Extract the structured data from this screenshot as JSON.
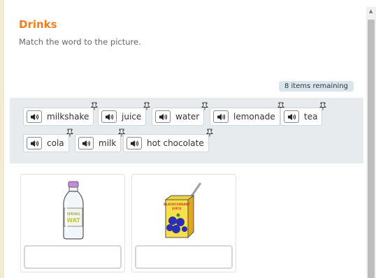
{
  "activity": {
    "title": "Drinks",
    "instructions": "Match the word to the picture.",
    "remaining": "8 items remaining"
  },
  "words": [
    {
      "label": "milkshake"
    },
    {
      "label": "juice"
    },
    {
      "label": "water"
    },
    {
      "label": "lemonade"
    },
    {
      "label": "tea"
    },
    {
      "label": "cola"
    },
    {
      "label": "milk"
    },
    {
      "label": "hot chocolate"
    }
  ],
  "pictures": [
    {
      "name": "water-bottle",
      "bottle_text_1": "SPRING",
      "bottle_text_2": "WAT"
    },
    {
      "name": "juice-box",
      "box_text_1": "BLACKCURRANT",
      "box_text_2": "JUICE"
    }
  ],
  "colors": {
    "accent": "#f07d20",
    "bank": "#e7ebed",
    "badge": "#d9e6ee"
  }
}
